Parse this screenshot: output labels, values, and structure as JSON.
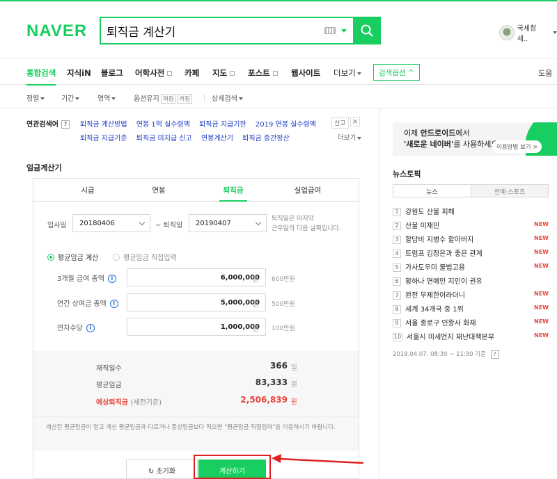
{
  "header": {
    "logo": "NAVER",
    "search_query": "퇴직금 계산기",
    "user_name": "국세청 세.."
  },
  "nav": {
    "items": [
      "통합검색",
      "지식iN",
      "블로그",
      "어학사전",
      "카페",
      "지도",
      "포스트",
      "웹사이트",
      "더보기"
    ],
    "search_options": "검색옵션 ^",
    "help": "도움"
  },
  "filters": {
    "sort": "정렬",
    "period": "기간",
    "area": "영역",
    "keep_option": "옵션유지",
    "keep_on": "꺼짐",
    "keep_off": "켜짐",
    "detail": "상세검색"
  },
  "related": {
    "label": "연관검색어",
    "row1": [
      "퇴직금 계산방법",
      "연봉 1억 실수령액",
      "퇴직금 지급기한",
      "2019 연봉 실수령액"
    ],
    "row2": [
      "퇴직금 지급기준",
      "퇴직금 미지급 신고",
      "연봉계산기",
      "퇴직금 중간정산"
    ],
    "report": "신고",
    "more": "더보기"
  },
  "calculator": {
    "title": "임금계산기",
    "tabs": [
      "시급",
      "연봉",
      "퇴직금",
      "실업급여"
    ],
    "active_tab": "퇴직금",
    "start_label": "입사일",
    "start_value": "20180406",
    "end_label": "~ 퇴직일",
    "end_value": "20190407",
    "date_note_1": "퇴직일은 마지막",
    "date_note_2": "근무일의 다음 날짜입니다.",
    "radio_avg": "평균임금 계산",
    "radio_direct": "평균임금 직접입력",
    "fields": [
      {
        "label": "3개월 급여 총액",
        "value": "6,000,000",
        "unit": "원",
        "hint": "600만원"
      },
      {
        "label": "연간 상여금 총액",
        "value": "5,000,000",
        "unit": "원",
        "hint": "500만원"
      },
      {
        "label": "연차수당",
        "value": "1,000,000",
        "unit": "원",
        "hint": "100만원"
      }
    ],
    "results": [
      {
        "label": "재직일수",
        "value": "366",
        "unit": "일"
      },
      {
        "label": "평균임금",
        "value": "83,333",
        "unit": "원"
      },
      {
        "label": "예상퇴직금",
        "sub": "(세전기준)",
        "value": "2,506,839",
        "unit": "원"
      }
    ],
    "disclaimer": "계산된 평균임금이 알고 계신 평균임금과 다르거나 통상임금보다 적으면 \"평균임금 직접입력\"을 이용하시기 바랍니다.",
    "reset_label": "초기화",
    "calc_label": "계산하기"
  },
  "banner": {
    "line1_a": "이제 ",
    "line1_b": "안드로이드",
    "line1_c": "에서",
    "line2_a": "'새로운 네이버'",
    "line2_b": "를 사용하세요",
    "link": "이용방법 보기 >"
  },
  "news": {
    "title": "뉴스토픽",
    "tabs": [
      "뉴스",
      "연예·스포츠"
    ],
    "items": [
      {
        "rank": "1",
        "text": "강원도 산불 피해",
        "new": ""
      },
      {
        "rank": "2",
        "text": "산불 이재민",
        "new": "NEW"
      },
      {
        "rank": "3",
        "text": "할담비 지병수 할아버지",
        "new": "NEW"
      },
      {
        "rank": "4",
        "text": "트럼프 김정은과 좋은 관계",
        "new": "NEW"
      },
      {
        "rank": "5",
        "text": "가사도우미 불법고용",
        "new": "NEW"
      },
      {
        "rank": "6",
        "text": "황하나 연예인 지인이 권유",
        "new": ""
      },
      {
        "rank": "7",
        "text": "완전 무제한이라더니",
        "new": "NEW"
      },
      {
        "rank": "8",
        "text": "세계 34개국 중 1위",
        "new": "NEW"
      },
      {
        "rank": "9",
        "text": "서울 종로구 인왕사 화재",
        "new": "NEW"
      },
      {
        "rank": "10",
        "text": "서울시 미세먼지 재난대책본부",
        "new": "NEW"
      }
    ],
    "time": "2019.04.07. 08:30 ~ 11:30 기준"
  },
  "colors": {
    "brand": "#19ce60",
    "link": "#1a3ac5",
    "highlight": "#e02020"
  }
}
